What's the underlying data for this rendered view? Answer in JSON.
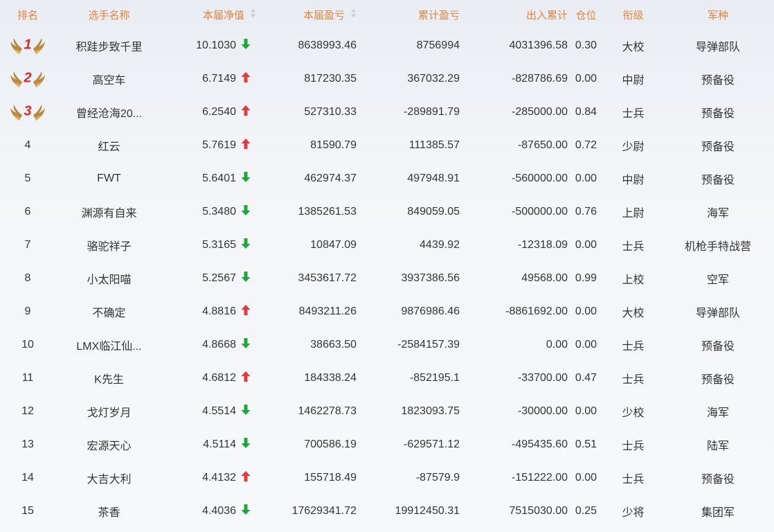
{
  "colors": {
    "header_text": "#e8843c",
    "up_arrow": "#e23b3b",
    "down_arrow": "#1fa83a",
    "medal_digit": "#d92a2a",
    "medal_wing": "#b98a3e"
  },
  "headers": {
    "rank": "排名",
    "name": "选手名称",
    "nav": "本届净值",
    "profit": "本届盈亏",
    "cum_profit": "累计盈亏",
    "flow": "出入累计",
    "position": "仓位",
    "grade": "衔级",
    "arm": "军种"
  },
  "rows": [
    {
      "rank": "1",
      "medal": true,
      "name": "积跬步致千里",
      "nav": "10.1030",
      "trend": "down",
      "profit": "8638993.46",
      "cum_profit": "8756994",
      "flow": "4031396.58",
      "position": "0.30",
      "grade": "大校",
      "arm": "导弹部队"
    },
    {
      "rank": "2",
      "medal": true,
      "name": "高空车",
      "nav": "6.7149",
      "trend": "up",
      "profit": "817230.35",
      "cum_profit": "367032.29",
      "flow": "-828786.69",
      "position": "0.00",
      "grade": "中尉",
      "arm": "预备役"
    },
    {
      "rank": "3",
      "medal": true,
      "name": "曾经沧海20...",
      "nav": "6.2540",
      "trend": "up",
      "profit": "527310.33",
      "cum_profit": "-289891.79",
      "flow": "-285000.00",
      "position": "0.84",
      "grade": "士兵",
      "arm": "预备役"
    },
    {
      "rank": "4",
      "medal": false,
      "name": "红云",
      "nav": "5.7619",
      "trend": "up",
      "profit": "81590.79",
      "cum_profit": "111385.57",
      "flow": "-87650.00",
      "position": "0.72",
      "grade": "少尉",
      "arm": "预备役"
    },
    {
      "rank": "5",
      "medal": false,
      "name": "FWT",
      "nav": "5.6401",
      "trend": "down",
      "profit": "462974.37",
      "cum_profit": "497948.91",
      "flow": "-560000.00",
      "position": "0.00",
      "grade": "中尉",
      "arm": "预备役"
    },
    {
      "rank": "6",
      "medal": false,
      "name": "渊源有自来",
      "nav": "5.3480",
      "trend": "down",
      "profit": "1385261.53",
      "cum_profit": "849059.05",
      "flow": "-500000.00",
      "position": "0.76",
      "grade": "上尉",
      "arm": "海军"
    },
    {
      "rank": "7",
      "medal": false,
      "name": "骆驼祥子",
      "nav": "5.3165",
      "trend": "down",
      "profit": "10847.09",
      "cum_profit": "4439.92",
      "flow": "-12318.09",
      "position": "0.00",
      "grade": "士兵",
      "arm": "机枪手特战营"
    },
    {
      "rank": "8",
      "medal": false,
      "name": "小太阳喵",
      "nav": "5.2567",
      "trend": "down",
      "profit": "3453617.72",
      "cum_profit": "3937386.56",
      "flow": "49568.00",
      "position": "0.99",
      "grade": "上校",
      "arm": "空军"
    },
    {
      "rank": "9",
      "medal": false,
      "name": "不确定",
      "nav": "4.8816",
      "trend": "up",
      "profit": "8493211.26",
      "cum_profit": "9876986.46",
      "flow": "-8861692.00",
      "position": "0.00",
      "grade": "大校",
      "arm": "导弹部队"
    },
    {
      "rank": "10",
      "medal": false,
      "name": "LMX临江仙...",
      "nav": "4.8668",
      "trend": "down",
      "profit": "38663.50",
      "cum_profit": "-2584157.39",
      "flow": "0.00",
      "position": "0.00",
      "grade": "士兵",
      "arm": "预备役"
    },
    {
      "rank": "11",
      "medal": false,
      "name": "K先生",
      "nav": "4.6812",
      "trend": "up",
      "profit": "184338.24",
      "cum_profit": "-852195.1",
      "flow": "-33700.00",
      "position": "0.47",
      "grade": "士兵",
      "arm": "预备役"
    },
    {
      "rank": "12",
      "medal": false,
      "name": "戈灯岁月",
      "nav": "4.5514",
      "trend": "down",
      "profit": "1462278.73",
      "cum_profit": "1823093.75",
      "flow": "-30000.00",
      "position": "0.00",
      "grade": "少校",
      "arm": "海军"
    },
    {
      "rank": "13",
      "medal": false,
      "name": "宏源天心",
      "nav": "4.5114",
      "trend": "down",
      "profit": "700586.19",
      "cum_profit": "-629571.12",
      "flow": "-495435.60",
      "position": "0.51",
      "grade": "士兵",
      "arm": "陆军"
    },
    {
      "rank": "14",
      "medal": false,
      "name": "大吉大利",
      "nav": "4.4132",
      "trend": "up",
      "profit": "155718.49",
      "cum_profit": "-87579.9",
      "flow": "-151222.00",
      "position": "0.00",
      "grade": "士兵",
      "arm": "预备役"
    },
    {
      "rank": "15",
      "medal": false,
      "name": "茶香",
      "nav": "4.4036",
      "trend": "down",
      "profit": "17629341.72",
      "cum_profit": "19912450.31",
      "flow": "7515030.00",
      "position": "0.25",
      "grade": "少将",
      "arm": "集团军"
    }
  ]
}
